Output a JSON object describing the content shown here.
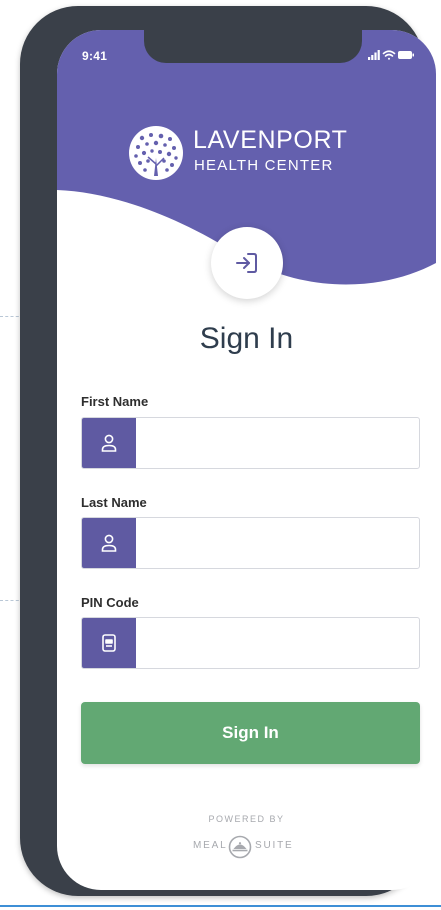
{
  "status_bar": {
    "time": "9:41"
  },
  "brand": {
    "name": "LAVENPORT",
    "subtitle": "HEALTH CENTER"
  },
  "title": "Sign In",
  "form": {
    "first_name": {
      "label": "First Name",
      "value": "",
      "icon": "person-icon"
    },
    "last_name": {
      "label": "Last Name",
      "value": "",
      "icon": "person-icon"
    },
    "pin_code": {
      "label": "PIN Code",
      "value": "",
      "icon": "id-badge-icon"
    }
  },
  "submit_label": "Sign In",
  "footer": {
    "powered_by": "POWERED BY",
    "meal": "MEAL",
    "suite": "SUITE"
  },
  "colors": {
    "header": "#6460ae",
    "icon_box": "#5f5aa2",
    "button": "#62a873",
    "title_text": "#2f3d4d"
  }
}
